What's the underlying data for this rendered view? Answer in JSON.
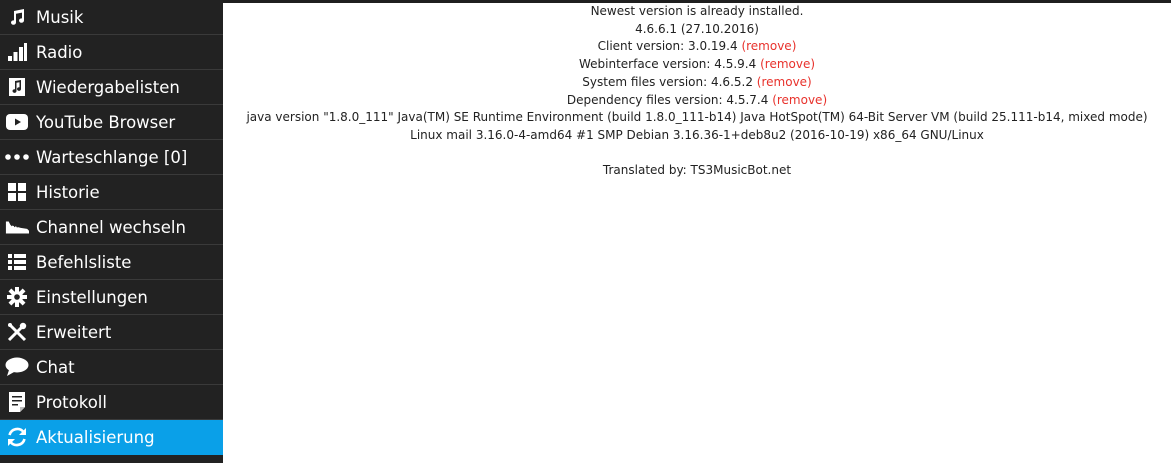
{
  "sidebar": {
    "items": [
      {
        "label": "Musik",
        "icon": "music-note-icon"
      },
      {
        "label": "Radio",
        "icon": "signal-bars-icon"
      },
      {
        "label": "Wiedergabelisten",
        "icon": "playlist-icon"
      },
      {
        "label": "YouTube Browser",
        "icon": "youtube-icon"
      },
      {
        "label": "Warteschlange [0]",
        "icon": "dots-icon"
      },
      {
        "label": "Historie",
        "icon": "grid-icon"
      },
      {
        "label": "Channel wechseln",
        "icon": "shoe-icon"
      },
      {
        "label": "Befehlsliste",
        "icon": "list-icon"
      },
      {
        "label": "Einstellungen",
        "icon": "gear-icon"
      },
      {
        "label": "Erweitert",
        "icon": "tools-icon"
      },
      {
        "label": "Chat",
        "icon": "speech-bubble-icon"
      },
      {
        "label": "Protokoll",
        "icon": "document-icon"
      },
      {
        "label": "Aktualisierung",
        "icon": "refresh-icon",
        "active": true
      }
    ],
    "active_color": "#0aa0e8"
  },
  "main": {
    "newest_msg": "Newest version is already installed.",
    "version_line": "4.6.6.1 (27.10.2016)",
    "client_label": "Client version: 3.0.19.4",
    "webinterface_label": "Webinterface version: 4.5.9.4",
    "system_files_label": "System files version: 4.6.5.2",
    "dependency_label": "Dependency files version: 4.5.7.4",
    "remove_label": "(remove)",
    "java_line": "java version \"1.8.0_111\" Java(TM) SE Runtime Environment (build 1.8.0_111-b14) Java HotSpot(TM) 64-Bit Server VM (build 25.111-b14, mixed mode)",
    "linux_line": "Linux mail 3.16.0-4-amd64 #1 SMP Debian 3.16.36-1+deb8u2 (2016-10-19) x86_64 GNU/Linux",
    "translated_by": "Translated by: TS3MusicBot.net",
    "remove_color": "#e8322c"
  }
}
